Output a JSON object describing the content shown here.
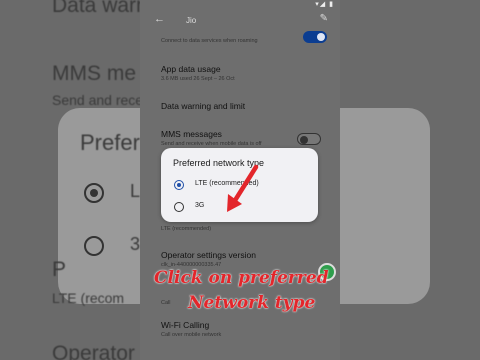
{
  "background": {
    "lines": [
      {
        "text": "Data warnir"
      },
      {
        "text": "MMS me"
      },
      {
        "text": "Send and rece"
      },
      {
        "text": "Prefer"
      },
      {
        "text": "L"
      },
      {
        "text": "3"
      },
      {
        "text": "P"
      },
      {
        "text": "LTE (recom"
      },
      {
        "text": "Operator"
      }
    ]
  },
  "status_bar": {
    "time": "",
    "icons": "▾◢ ▮"
  },
  "app_bar": {
    "back_icon": "arrow-left-icon",
    "title": "Jio",
    "edit_icon": "pencil-icon"
  },
  "settings": {
    "roaming_sub": "Connect to data services when roaming",
    "app_data_usage": {
      "title": "App data usage",
      "subtitle": "3.6 MB used 26 Sept – 26 Oct"
    },
    "data_warning": {
      "title": "Data warning and limit"
    },
    "mms": {
      "title": "MMS messages",
      "subtitle": "Send and receive when mobile data is off"
    },
    "preferred_sub": "LTE (recommended)",
    "operator": {
      "title": "Operator settings version",
      "subtitle": "clk_in-440000000335.47"
    },
    "calling_sub": "Call",
    "wifi_calling": {
      "title": "Wi-Fi Calling",
      "subtitle": "Call over mobile network"
    }
  },
  "dialog": {
    "title": "Preferred network type",
    "options": [
      {
        "label": "LTE (recommended)",
        "selected": true
      },
      {
        "label": "3G",
        "selected": false
      }
    ]
  },
  "annotation": {
    "line1": "Click on preferred",
    "line2": "Network type",
    "color": "#e3262b"
  },
  "colors": {
    "accent": "#1f4fa8",
    "toggle_on": "#0b3d91"
  }
}
